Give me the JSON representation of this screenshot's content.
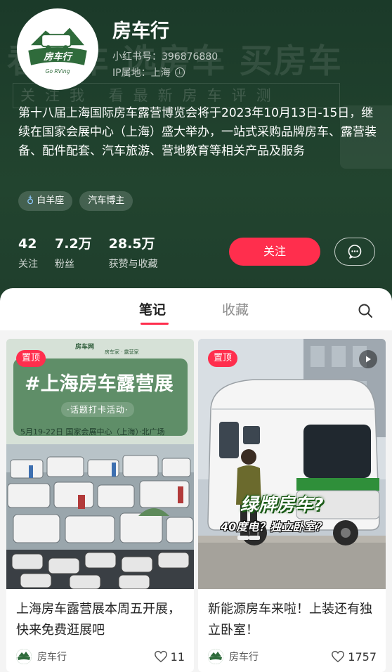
{
  "profile": {
    "name": "房车行",
    "id_label": "小红书号：396876880",
    "ip_label": "IP属地：上海",
    "bio": "第十八届上海国际房车露营博览会将于2023年10月13日-15日，继续在国家会展中心（上海）盛大举办，一站式采购品牌房车、露营装备、配件配套、汽车旅游、营地教育等相关产品及服务",
    "avatar_text_main": "房车行",
    "avatar_text_sub": "Go RVing",
    "banner_slogan": "看房车 选房车 买房车",
    "banner_sub": "关注我 看最新房车评测"
  },
  "tags": [
    {
      "label": "白羊座",
      "icon": "female-icon"
    },
    {
      "label": "汽车博主"
    }
  ],
  "stats": [
    {
      "value": "42",
      "label": "关注"
    },
    {
      "value": "7.2万",
      "label": "粉丝"
    },
    {
      "value": "28.5万",
      "label": "获赞与收藏"
    }
  ],
  "actions": {
    "follow_label": "关注",
    "message_icon": "chat-bubble-icon"
  },
  "tabs": {
    "notes": "笔记",
    "collections": "收藏",
    "search_icon": "search-icon"
  },
  "notes": [
    {
      "badge": "置顶",
      "cover_title": "#上海房车露营展",
      "cover_sub": "·话题打卡活动·",
      "cover_date": "5月19-22日  国家会展中心（上海）·北广场",
      "cover_logo_a": "房车网",
      "cover_logo_b": "房车家 · 露营家",
      "title": "上海房车露营展本周五开展，快来免费逛展吧",
      "author": "房车行",
      "likes": "11"
    },
    {
      "badge": "置顶",
      "video": true,
      "cover_big": "绿牌房车?",
      "cover_small": "40度电？独立卧室？",
      "title": "新能源房车来啦！上装还有独立卧室！",
      "author": "房车行",
      "likes": "1757"
    }
  ],
  "colors": {
    "accent": "#ff2e4d",
    "header_bg": "#1e3d2c"
  }
}
